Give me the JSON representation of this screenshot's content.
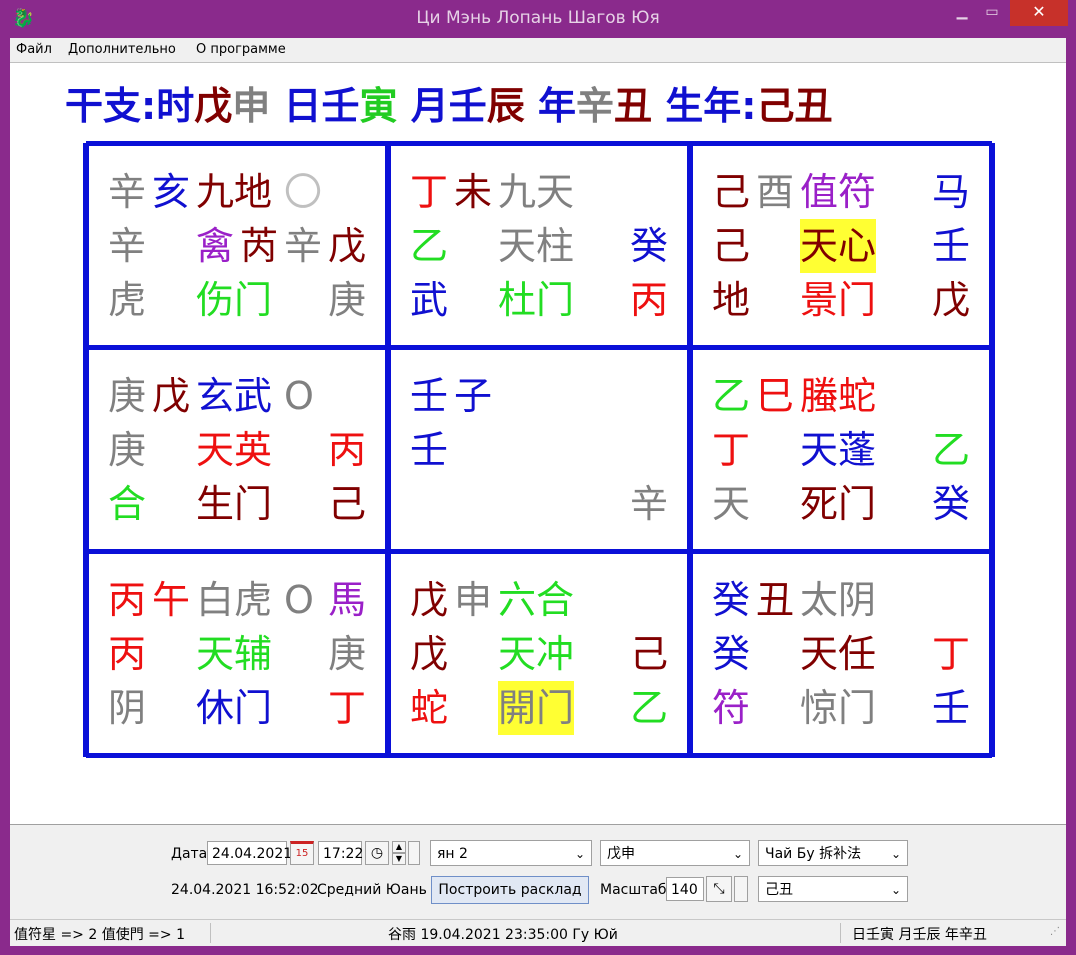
{
  "window": {
    "title": "Ци Мэнь Лопань Шагов Юя",
    "minimize": "▁",
    "maximize": "▭",
    "close": "✕",
    "app_icon": "dragon-icon"
  },
  "menu": [
    "Файл",
    "Дополнительно",
    "О программе"
  ],
  "ganzhi": [
    {
      "t": "干支:",
      "c": "#1010d0"
    },
    {
      "t": "时",
      "c": "#1010d0"
    },
    {
      "t": "戊",
      "c": "#800000"
    },
    {
      "t": "申",
      "c": "#808080"
    },
    {
      "t": " 日",
      "c": "#1010d0"
    },
    {
      "t": "壬",
      "c": "#1010d0"
    },
    {
      "t": "寅",
      "c": "#22cc22"
    },
    {
      "t": " 月",
      "c": "#1010d0"
    },
    {
      "t": "壬",
      "c": "#1010d0"
    },
    {
      "t": "辰",
      "c": "#800000"
    },
    {
      "t": " 年",
      "c": "#1010d0"
    },
    {
      "t": "辛",
      "c": "#808080"
    },
    {
      "t": "丑",
      "c": "#800000"
    },
    {
      "t": " 生年:",
      "c": "#1010d0"
    },
    {
      "t": "己丑",
      "c": "#800000"
    }
  ],
  "palaces": [
    [
      [
        [
          "辛",
          "#808080",
          0
        ],
        [
          "亥",
          "#1010d0",
          44
        ],
        [
          "九地",
          "#800000",
          88
        ],
        [
          "〇",
          "#c0c0c0",
          176
        ]
      ],
      [
        [
          "辛",
          "#808080",
          0
        ],
        [
          "禽",
          "#9a20c8",
          88
        ],
        [
          "芮",
          "#800000",
          132
        ],
        [
          "辛",
          "#808080",
          176
        ],
        [
          "戊",
          "#800000",
          220
        ]
      ],
      [
        [
          "虎",
          "#808080",
          0
        ],
        [
          "伤门",
          "#22dd22",
          88
        ],
        [
          "庚",
          "#808080",
          220
        ]
      ]
    ],
    [
      [
        [
          "丁",
          "#ee1010",
          0
        ],
        [
          "未",
          "#800000",
          44
        ],
        [
          "九天",
          "#808080",
          88
        ]
      ],
      [
        [
          "乙",
          "#22dd22",
          0
        ],
        [
          "天柱",
          "#808080",
          88
        ],
        [
          "癸",
          "#1010d0",
          220
        ]
      ],
      [
        [
          "武",
          "#1010d0",
          0
        ],
        [
          "杜门",
          "#22dd22",
          88
        ],
        [
          "丙",
          "#ee1010",
          220
        ]
      ]
    ],
    [
      [
        [
          "己",
          "#800000",
          0
        ],
        [
          "酉",
          "#808080",
          44
        ],
        [
          "值符",
          "#9a20c8",
          88
        ],
        [
          "马",
          "#1010d0",
          220
        ]
      ],
      [
        [
          "己",
          "#800000",
          0
        ],
        [
          "天心",
          "#800000",
          88,
          1
        ],
        [
          "壬",
          "#1010d0",
          220
        ]
      ],
      [
        [
          "地",
          "#800000",
          0
        ],
        [
          "景门",
          "#ee1010",
          88
        ],
        [
          "戊",
          "#800000",
          220
        ]
      ]
    ],
    [
      [
        [
          "庚",
          "#808080",
          0
        ],
        [
          "戊",
          "#800000",
          44
        ],
        [
          "玄武",
          "#1010d0",
          88
        ],
        [
          "O",
          "#808080",
          176
        ]
      ],
      [
        [
          "庚",
          "#808080",
          0
        ],
        [
          "天英",
          "#ee1010",
          88
        ],
        [
          "丙",
          "#ee1010",
          220
        ]
      ],
      [
        [
          "合",
          "#22dd22",
          0
        ],
        [
          "生门",
          "#800000",
          88
        ],
        [
          "己",
          "#800000",
          220
        ]
      ]
    ],
    [
      [
        [
          "壬",
          "#1010d0",
          0
        ],
        [
          "子",
          "#1010d0",
          44
        ]
      ],
      [
        [
          "壬",
          "#1010d0",
          0
        ]
      ],
      [
        [
          "辛",
          "#808080",
          220
        ]
      ]
    ],
    [
      [
        [
          "乙",
          "#22dd22",
          0
        ],
        [
          "巳",
          "#ee1010",
          44
        ],
        [
          "螣蛇",
          "#ee1010",
          88
        ]
      ],
      [
        [
          "丁",
          "#ee1010",
          0
        ],
        [
          "天蓬",
          "#1010d0",
          88
        ],
        [
          "乙",
          "#22dd22",
          220
        ]
      ],
      [
        [
          "天",
          "#808080",
          0
        ],
        [
          "死门",
          "#800000",
          88
        ],
        [
          "癸",
          "#1010d0",
          220
        ]
      ]
    ],
    [
      [
        [
          "丙",
          "#ee1010",
          0
        ],
        [
          "午",
          "#ee1010",
          44
        ],
        [
          "白虎",
          "#808080",
          88
        ],
        [
          "O",
          "#808080",
          176
        ],
        [
          "馬",
          "#9a20c8",
          220
        ]
      ],
      [
        [
          "丙",
          "#ee1010",
          0
        ],
        [
          "天辅",
          "#22dd22",
          88
        ],
        [
          "庚",
          "#808080",
          220
        ]
      ],
      [
        [
          "阴",
          "#808080",
          0
        ],
        [
          "休门",
          "#1010d0",
          88
        ],
        [
          "丁",
          "#ee1010",
          220
        ]
      ]
    ],
    [
      [
        [
          "戊",
          "#800000",
          0
        ],
        [
          "申",
          "#808080",
          44
        ],
        [
          "六合",
          "#22dd22",
          88
        ]
      ],
      [
        [
          "戊",
          "#800000",
          0
        ],
        [
          "天冲",
          "#22dd22",
          88
        ],
        [
          "己",
          "#800000",
          220
        ]
      ],
      [
        [
          "蛇",
          "#ee1010",
          0
        ],
        [
          "開门",
          "#808080",
          88,
          1
        ],
        [
          "乙",
          "#22dd22",
          220
        ]
      ]
    ],
    [
      [
        [
          "癸",
          "#1010d0",
          0
        ],
        [
          "丑",
          "#800000",
          44
        ],
        [
          "太阴",
          "#808080",
          88
        ]
      ],
      [
        [
          "癸",
          "#1010d0",
          0
        ],
        [
          "天任",
          "#800000",
          88
        ],
        [
          "丁",
          "#ee1010",
          220
        ]
      ],
      [
        [
          "符",
          "#9a20c8",
          0
        ],
        [
          "惊门",
          "#808080",
          88
        ],
        [
          "壬",
          "#1010d0",
          220
        ]
      ]
    ]
  ],
  "controls": {
    "date_label": "Дата",
    "date_value": "24.04.2021",
    "calendar_icon": "calendar-icon",
    "calendar_glyph": "15",
    "time_value": "17:22",
    "clock_icon": "clock-icon",
    "spin_up": "▲",
    "spin_down": "▼",
    "yang_select": "ян  2",
    "ganzhi_select": "戊申",
    "method_select": "Чай  Бу    拆补法",
    "timestamp": "24.04.2021 16:52:02",
    "timezone": "Средний Юань",
    "build_button": "Построить расклад",
    "scale_label": "Масштаб",
    "scale_value": "140",
    "year_select": "己丑",
    "dropdown_arrow": "⌄"
  },
  "statusbar": {
    "left": "值符星 => 2 值使門 => 1",
    "center": "谷雨 19.04.2021 23:35:00 Гу Юй",
    "right": "日壬寅 月壬辰 年辛丑"
  }
}
